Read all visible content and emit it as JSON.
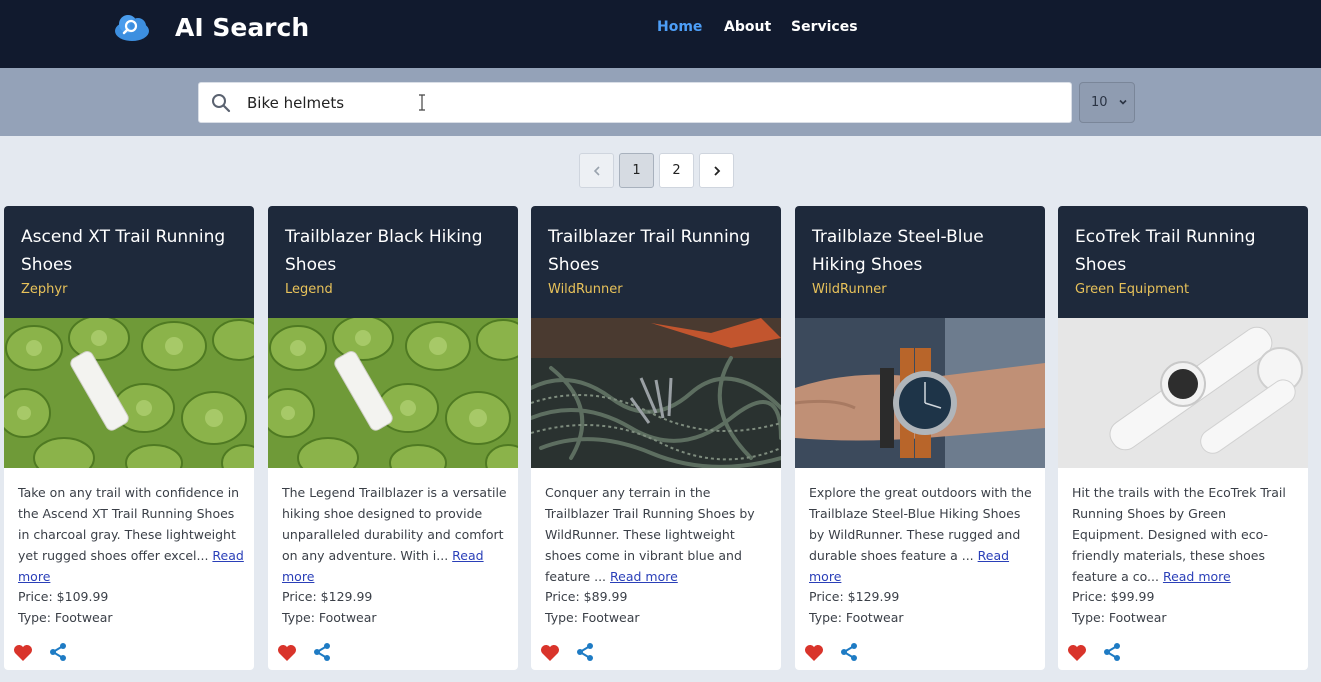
{
  "header": {
    "brand": "AI Search",
    "nav": [
      "Home",
      "About",
      "Services"
    ],
    "active_nav": "Home"
  },
  "search": {
    "value": "Bike helmets",
    "page_size": "10"
  },
  "pagination": {
    "pages": [
      "1",
      "2"
    ],
    "current": "1"
  },
  "colors": {
    "navbar": "#111a2e",
    "accent": "#4d9ef7",
    "brand_text": "#e8c25a",
    "heart": "#d9342b",
    "share": "#1e7bc4"
  },
  "products": [
    {
      "title": "Ascend XT Trail Running Shoes",
      "brand": "Zephyr",
      "description": "Take on any trail with confidence in the Ascend XT Trail Running Shoes in charcoal gray. These lightweight yet rugged shoes offer excel...",
      "read_more": "Read more",
      "price": "Price: $109.99",
      "type": "Type: Footwear",
      "image": "white-bottle-on-succulents"
    },
    {
      "title": "Trailblazer Black Hiking Shoes",
      "brand": "Legend",
      "description": "The Legend Trailblazer is a versatile hiking shoe designed to provide unparalleled durability and comfort on any adventure. With i...",
      "read_more": "Read more",
      "price": "Price: $129.99",
      "type": "Type: Footwear",
      "image": "white-bottle-on-succulents"
    },
    {
      "title": "Trailblazer Trail Running Shoes",
      "brand": "WildRunner",
      "description": "Conquer any terrain in the Trailblazer Trail Running Shoes by WildRunner. These lightweight shoes come in vibrant blue and feature ...",
      "read_more": "Read more",
      "price": "Price: $89.99",
      "type": "Type: Footwear",
      "image": "climbing-rope-and-carabiners"
    },
    {
      "title": "Trailblaze Steel-Blue Hiking Shoes",
      "brand": "WildRunner",
      "description": "Explore the great outdoors with the Trailblaze Steel-Blue Hiking Shoes by WildRunner. These rugged and durable shoes feature a ...",
      "read_more": "Read more",
      "price": "Price: $129.99",
      "type": "Type: Footwear",
      "image": "wrist-watch"
    },
    {
      "title": "EcoTrek Trail Running Shoes",
      "brand": "Green Equipment",
      "description": "Hit the trails with the EcoTrek Trail Running Shoes by Green Equipment. Designed with eco-friendly materials, these shoes feature a co...",
      "read_more": "Read more",
      "price": "Price: $99.99",
      "type": "Type: Footwear",
      "image": "white-smartwatches"
    }
  ]
}
